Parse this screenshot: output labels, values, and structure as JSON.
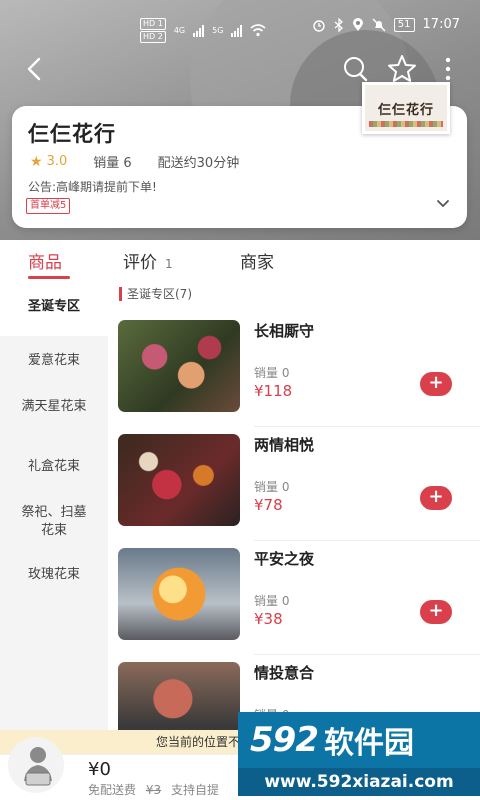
{
  "status_bar": {
    "sim1": "HD 1",
    "sim2": "HD 2",
    "net1": "4G",
    "net2": "5G",
    "battery": "51",
    "time": "17:07"
  },
  "shop": {
    "name": "仨仨花行",
    "logo_text": "仨仨花行",
    "rating": "3.0",
    "sales": "销量 6",
    "delivery": "配送约30分钟",
    "notice": "公告:高峰期请提前下单!",
    "coupon": "首单减5"
  },
  "tabs": [
    {
      "label": "商品",
      "count": ""
    },
    {
      "label": "评价",
      "count": "1"
    },
    {
      "label": "商家",
      "count": ""
    }
  ],
  "categories": [
    "圣诞专区",
    "爱意花束",
    "满天星花束",
    "礼盒花束",
    "祭祀、扫墓花束",
    "玫瑰花束"
  ],
  "section_title": "圣诞专区(7)",
  "products": [
    {
      "name": "长相厮守",
      "sales": "销量 0",
      "price": "¥118"
    },
    {
      "name": "两情相悦",
      "sales": "销量 0",
      "price": "¥78"
    },
    {
      "name": "平安之夜",
      "sales": "销量 0",
      "price": "¥38"
    },
    {
      "name": "情投意合",
      "sales": "销量 0",
      "price": ""
    }
  ],
  "location_banner": "您当前的位置不在商家配送范围",
  "bottom_bar": {
    "total": "¥0",
    "free_delivery": "免配送费",
    "old_fee": "¥3",
    "self_pickup": "支持自提"
  },
  "watermark": {
    "number": "592",
    "brand": "软件园",
    "url": "www.592xiazai.com"
  },
  "colors": {
    "accent": "#d9404b",
    "rating": "#e8a33a",
    "banner": "#fbeecd",
    "watermark": "#0d74a6"
  },
  "icons": [
    "back-icon",
    "search-icon",
    "favorite-star-icon",
    "more-icon",
    "expand-chevron-icon",
    "add-icon",
    "cart-icon"
  ]
}
